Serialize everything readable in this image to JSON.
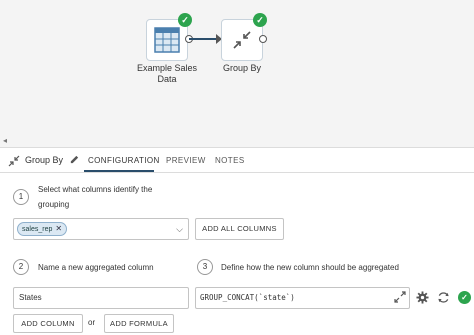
{
  "canvas": {
    "node_a_label": "Example Sales Data",
    "node_b_label": "Group By"
  },
  "tabbar": {
    "title": "Group By",
    "tabs": [
      "CONFIGURATION",
      "PREVIEW",
      "NOTES"
    ],
    "active_tab": "CONFIGURATION"
  },
  "step1": {
    "number": "1",
    "text": "Select what columns identify the grouping",
    "selected_chip": "sales_rep",
    "add_all_label": "ADD ALL COLUMNS"
  },
  "step2": {
    "number": "2",
    "text": "Name a new aggregated column",
    "value": "States"
  },
  "step3": {
    "number": "3",
    "text": "Define how the new column should be aggregated",
    "expression": "GROUP_CONCAT(`state`)"
  },
  "footer": {
    "add_column_label": "ADD COLUMN",
    "or_label": "or",
    "add_formula_label": "ADD FORMULA"
  },
  "colors": {
    "accent": "#2a4d6b",
    "success": "#2da44e",
    "chip_bg": "#dbe8f3"
  },
  "icons": [
    "table-icon",
    "compress-arrows-icon",
    "check-icon",
    "pencil-icon",
    "chevron-down-icon",
    "expand-icon",
    "gear-icon",
    "refresh-icon"
  ]
}
